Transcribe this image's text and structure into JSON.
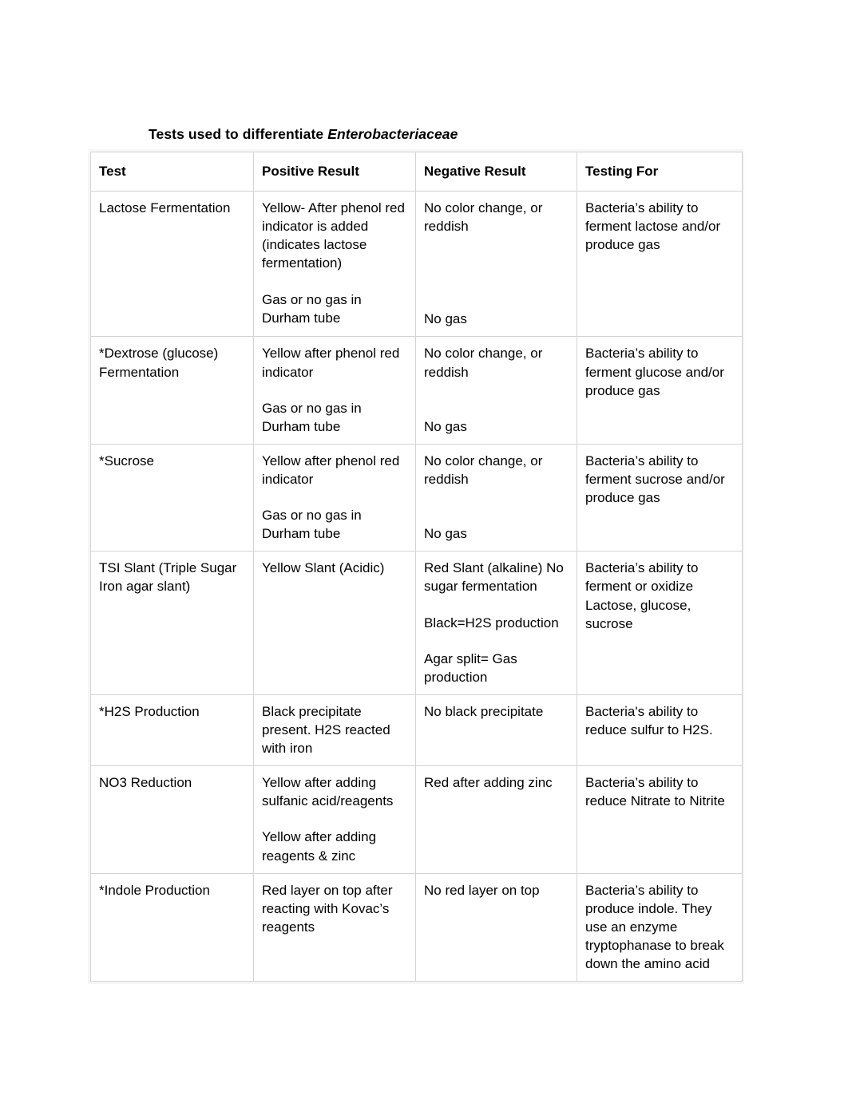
{
  "document": {
    "title_prefix": "Tests used to differentiate ",
    "title_species": "Enterobacteriaceae"
  },
  "table": {
    "headers": {
      "test": "Test",
      "positive": "Positive Result",
      "negative": "Negative Result",
      "testing_for": "Testing For"
    },
    "rows": [
      {
        "test": "Lactose Fermentation",
        "positive_1": "Yellow- After phenol red indicator is added (indicates lactose fermentation)",
        "positive_2": "Gas or no gas in Durham tube",
        "negative_1": "No color change, or reddish",
        "negative_2": "No gas",
        "testing_for": "Bacteria’s ability to ferment lactose and/or produce gas"
      },
      {
        "test": "*Dextrose (glucose) Fermentation",
        "positive_1": "Yellow after phenol red indicator",
        "positive_2": "Gas or no gas in Durham tube",
        "negative_1": "No color change, or reddish",
        "negative_2": "No gas",
        "testing_for": "Bacteria’s ability to ferment glucose and/or produce gas"
      },
      {
        "test": "*Sucrose",
        "positive_1": "Yellow after phenol red indicator",
        "positive_2": "Gas or no gas in Durham tube",
        "negative_1": "No color change, or reddish",
        "negative_2": "No gas",
        "testing_for": "Bacteria’s ability to ferment sucrose and/or produce gas"
      },
      {
        "test": "TSI Slant (Triple Sugar Iron agar slant)",
        "positive_1": "Yellow Slant (Acidic)",
        "positive_2": "",
        "negative_1": "Red Slant (alkaline) No sugar fermentation",
        "negative_2": "Black=H2S production",
        "negative_3": "Agar split= Gas production",
        "testing_for": "Bacteria’s ability to ferment or oxidize Lactose, glucose, sucrose"
      },
      {
        "test": "*H2S Production",
        "positive_1": "Black precipitate present. H2S reacted with iron",
        "positive_2": "",
        "negative_1": "No black precipitate",
        "negative_2": "",
        "testing_for": "Bacteria's ability to reduce sulfur to H2S."
      },
      {
        "test": "NO3 Reduction",
        "positive_1": "Yellow after adding sulfanic acid/reagents",
        "positive_2": "Yellow after adding reagents & zinc",
        "negative_1": "Red after adding zinc",
        "negative_2": "",
        "testing_for": "Bacteria’s ability to reduce Nitrate to Nitrite"
      },
      {
        "test": "*Indole Production",
        "positive_1": "Red layer on top after reacting with Kovac’s reagents",
        "positive_2": "",
        "negative_1": "No red layer on top",
        "negative_2": "",
        "testing_for": "Bacteria’s ability to produce indole. They use an enzyme tryptophanase to break down the amino acid"
      }
    ]
  }
}
